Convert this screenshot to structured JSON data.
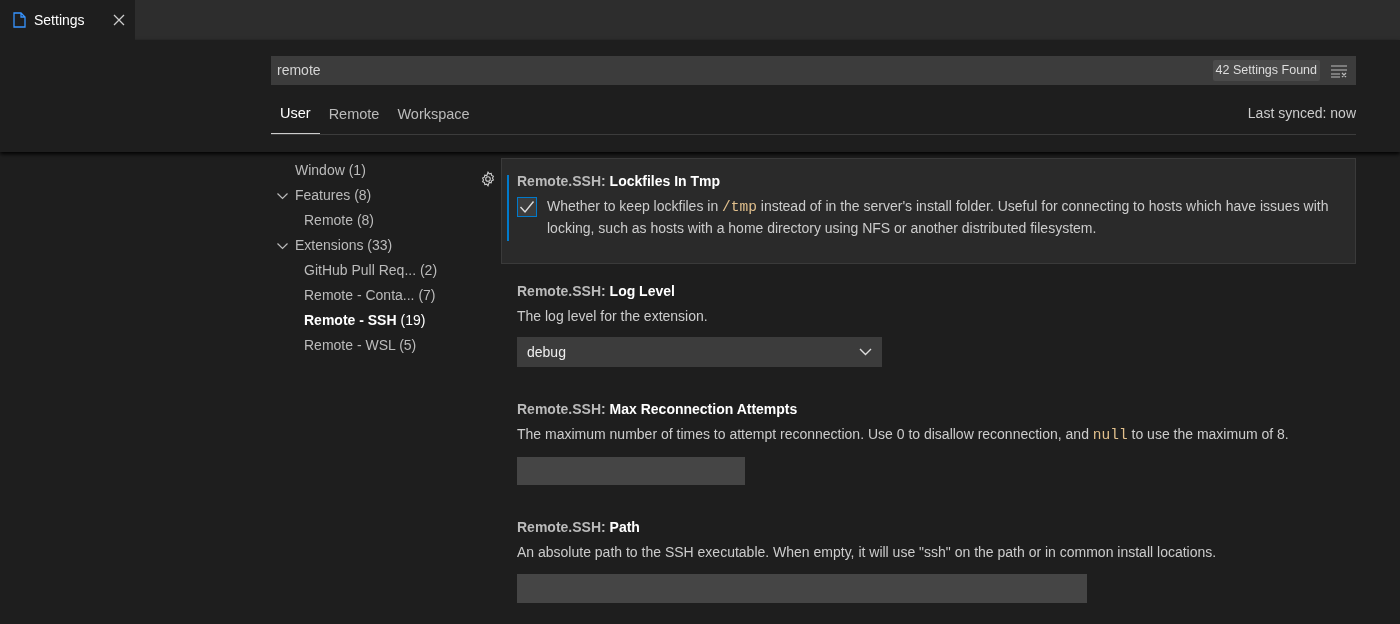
{
  "editor_tab": {
    "title": "Settings",
    "selected": true
  },
  "search": {
    "value": "remote",
    "result_count": "42 Settings Found"
  },
  "scope_tabs": [
    {
      "label": "User",
      "selected": true
    },
    {
      "label": "Remote",
      "selected": false
    },
    {
      "label": "Workspace",
      "selected": false
    }
  ],
  "sync_status": "Last synced: now",
  "toc": [
    {
      "label": "Window",
      "count": "(1)",
      "selected": false
    },
    {
      "label": "Features",
      "count": "(8)",
      "selected": false,
      "expanded": true,
      "children": [
        {
          "label": "Remote",
          "count": "(8)",
          "selected": false
        }
      ]
    },
    {
      "label": "Extensions",
      "count": "(33)",
      "selected": false,
      "expanded": true,
      "children": [
        {
          "label": "GitHub Pull Req...",
          "count": "(2)",
          "selected": false
        },
        {
          "label": "Remote - Conta...",
          "count": "(7)",
          "selected": false
        },
        {
          "label": "Remote - SSH",
          "count": "(19)",
          "selected": true
        },
        {
          "label": "Remote - WSL",
          "count": "(5)",
          "selected": false
        }
      ]
    }
  ],
  "settings": [
    {
      "kind": "checkbox",
      "category": "Remote.SSH: ",
      "name": "Lockfiles In Tmp",
      "focused": true,
      "checked": true,
      "description": [
        {
          "kind": "text",
          "text": "Whether to keep lockfiles in "
        },
        {
          "kind": "code",
          "text": "/tmp"
        },
        {
          "kind": "text",
          "text": " instead of in the server's install folder. Useful for connecting to hosts which have issues with locking, such as hosts with a home directory using NFS or another distributed filesystem."
        }
      ]
    },
    {
      "kind": "dropdown",
      "category": "Remote.SSH: ",
      "name": "Log Level",
      "focused": false,
      "value": "debug",
      "description": [
        {
          "kind": "text",
          "text": "The log level for the extension."
        }
      ]
    },
    {
      "kind": "number",
      "category": "Remote.SSH: ",
      "name": "Max Reconnection Attempts",
      "focused": false,
      "description": [
        {
          "kind": "text",
          "text": "The maximum number of times to attempt reconnection. Use 0 to disallow reconnection, and "
        },
        {
          "kind": "code",
          "text": "null"
        },
        {
          "kind": "text",
          "text": " to use the maximum of 8."
        }
      ]
    },
    {
      "kind": "text",
      "category": "Remote.SSH: ",
      "name": "Path",
      "focused": false,
      "description": [
        {
          "kind": "text",
          "text": "An absolute path to the SSH executable. When empty, it will use \"ssh\" on the path or in common install locations."
        }
      ]
    }
  ]
}
